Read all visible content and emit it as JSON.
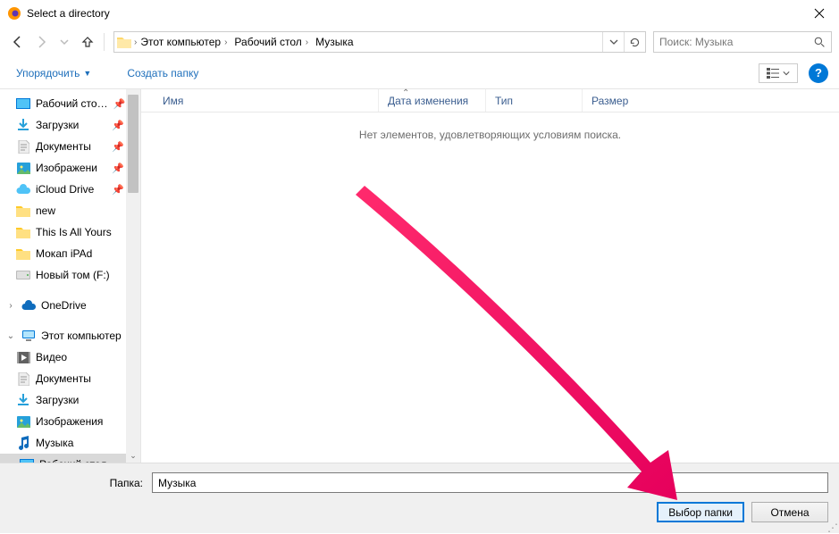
{
  "title": "Select a directory",
  "breadcrumb": {
    "items": [
      "Этот компьютер",
      "Рабочий стол",
      "Музыка"
    ]
  },
  "search": {
    "placeholder": "Поиск: Музыка"
  },
  "toolbar": {
    "organize": "Упорядочить",
    "newfolder": "Создать папку"
  },
  "sidebar": {
    "items": [
      {
        "label": "Рабочий сто…",
        "pinned": true,
        "level": 2,
        "icon": "desktop"
      },
      {
        "label": "Загрузки",
        "pinned": true,
        "level": 2,
        "icon": "downloads"
      },
      {
        "label": "Документы",
        "pinned": true,
        "level": 2,
        "icon": "documents"
      },
      {
        "label": "Изображени",
        "pinned": true,
        "level": 2,
        "icon": "pictures"
      },
      {
        "label": "iCloud Drive",
        "pinned": true,
        "level": 2,
        "icon": "icloud"
      },
      {
        "label": "new",
        "level": 2,
        "icon": "folder"
      },
      {
        "label": "This Is All Yours",
        "level": 2,
        "icon": "folder"
      },
      {
        "label": "Мокап iPAd",
        "level": 2,
        "icon": "folder"
      },
      {
        "label": "Новый том (F:)",
        "level": 2,
        "icon": "drive"
      },
      {
        "gap": true
      },
      {
        "label": "OneDrive",
        "level": 1,
        "icon": "onedrive",
        "exp": "›"
      },
      {
        "gap": true
      },
      {
        "label": "Этот компьютер",
        "level": 1,
        "icon": "pc",
        "exp": "⌄"
      },
      {
        "label": "Видео",
        "level": 2,
        "icon": "videos"
      },
      {
        "label": "Документы",
        "level": 2,
        "icon": "documents"
      },
      {
        "label": "Загрузки",
        "level": 2,
        "icon": "downloads"
      },
      {
        "label": "Изображения",
        "level": 2,
        "icon": "pictures"
      },
      {
        "label": "Музыка",
        "level": 2,
        "icon": "music"
      },
      {
        "label": "Рабочий стол",
        "level": 2,
        "icon": "desktop",
        "selected": true,
        "exp": "›"
      }
    ]
  },
  "columns": {
    "name": "Имя",
    "date": "Дата изменения",
    "type": "Тип",
    "size": "Размер"
  },
  "empty_msg": "Нет элементов, удовлетворяющих условиям поиска.",
  "footer": {
    "folder_label": "Папка:",
    "folder_value": "Музыка",
    "select": "Выбор папки",
    "cancel": "Отмена"
  }
}
